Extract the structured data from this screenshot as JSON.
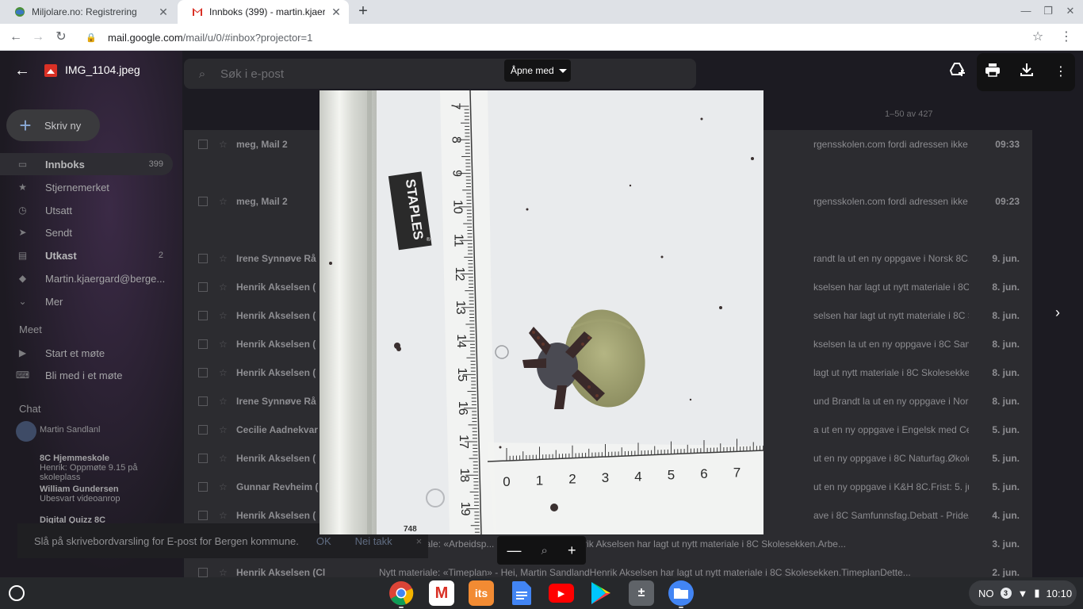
{
  "browser": {
    "tabs": [
      {
        "title": "Miljolare.no: Registrering",
        "active": false
      },
      {
        "title": "Innboks (399) - martin.kjaergard@",
        "active": true
      }
    ],
    "new_tab": "+",
    "url_host": "mail.google.com",
    "url_path": "/mail/u/0/#inbox?projector=1"
  },
  "gmail": {
    "search_placeholder": "Søk i e-post",
    "compose_label": "Skriv ny",
    "pagination": "1–50 av 427",
    "nav": [
      {
        "label": "Innboks",
        "count": "399",
        "icon": "inbox-icon"
      },
      {
        "label": "Stjernemerket",
        "count": "",
        "icon": "star-icon"
      },
      {
        "label": "Utsatt",
        "count": "",
        "icon": "clock-icon"
      },
      {
        "label": "Sendt",
        "count": "",
        "icon": "send-icon"
      },
      {
        "label": "Utkast",
        "count": "2",
        "icon": "draft-icon"
      },
      {
        "label": "Martin.kjaergard@berge...",
        "count": "",
        "icon": "label-icon"
      },
      {
        "label": "Mer",
        "count": "",
        "icon": "chevron-down-icon"
      }
    ],
    "meet_heading": "Meet",
    "meet": [
      {
        "label": "Start et møte",
        "icon": "video-icon"
      },
      {
        "label": "Bli med i et møte",
        "icon": "keyboard-icon"
      }
    ],
    "chat_heading": "Chat",
    "chat_user": "Martin Sandlanl",
    "chats": [
      {
        "name": "8C Hjemmeskole",
        "preview": "Henrik: Oppmøte 9.15 på skoleplass"
      },
      {
        "name": "William Gundersen",
        "preview": "Ubesvart videoanrop"
      },
      {
        "name": "Digital Quizz 8C",
        "preview": ""
      }
    ],
    "rows": [
      {
        "sender": "meg, Mail 2",
        "snippet": "rgensskolen.com fordi adressen ikke fin...",
        "date": "09:33"
      },
      {
        "sender": "meg, Mail 2",
        "snippet": "rgensskolen.com fordi adressen ikke fi...",
        "date": "09:23"
      },
      {
        "sender": "Irene Synnøve Rå",
        "snippet": "randt la ut en ny oppgave i Norsk 8C. Å ...",
        "date": "9. jun."
      },
      {
        "sender": "Henrik Akselsen (",
        "snippet": "kselsen har lagt ut nytt materiale i 8C ...",
        "date": "8. jun."
      },
      {
        "sender": "Henrik Akselsen (",
        "snippet": "selsen har lagt ut nytt materiale i 8C Sko...",
        "date": "8. jun."
      },
      {
        "sender": "Henrik Akselsen (",
        "snippet": "kselsen la ut en ny oppgave i 8C Samf...",
        "date": "8. jun."
      },
      {
        "sender": "Henrik Akselsen (",
        "snippet": "lagt ut nytt materiale i 8C Skolesekken.A...",
        "date": "8. jun."
      },
      {
        "sender": "Irene Synnøve Rå",
        "snippet": "und Brandt la ut en ny oppgave i Norsk ...",
        "date": "8. jun."
      },
      {
        "sender": "Cecilie Aadnekvar",
        "snippet": "a ut en ny oppgave i Engelsk med Cecil...",
        "date": "5. jun."
      },
      {
        "sender": "Henrik Akselsen (",
        "snippet": "ut en ny oppgave i 8C Naturfag.Økologi ...",
        "date": "5. jun."
      },
      {
        "sender": "Gunnar Revheim (",
        "snippet": "ut en ny oppgave i K&H 8C.Frist: 5. jun.D...",
        "date": "5. jun."
      },
      {
        "sender": "Henrik Akselsen (",
        "snippet": "ave i 8C Samfunnsfag.Debatt - PrideÅP...",
        "date": "4. jun."
      },
      {
        "sender": "",
        "snippet": "iale: «Arbeidsp... Martin SandlandHenrik Akselsen har lagt ut nytt materiale i 8C Skolesekken.Arbe...",
        "date": "3. jun."
      },
      {
        "sender": "Henrik Akselsen (Cl",
        "snippet": "Nytt materiale: «Timeplan» - Hei, Martin SandlandHenrik Akselsen har lagt ut nytt materiale i 8C Skolesekken.TimeplanDette...",
        "date": "2. jun."
      }
    ],
    "toast": {
      "text": "Slå på skrivebordvarsling for E-post for Bergen kommune.",
      "ok": "OK",
      "no": "Nei takk",
      "close": "×"
    }
  },
  "viewer": {
    "filename": "IMG_1104.jpeg",
    "open_with": "Åpne med",
    "ruler_labels_vertical": [
      "7",
      "8",
      "9",
      "10",
      "11",
      "12",
      "13",
      "14",
      "15",
      "16",
      "17",
      "18",
      "19"
    ],
    "ruler_labels_horizontal": [
      "0",
      "1",
      "2",
      "3",
      "4",
      "5",
      "6",
      "7"
    ],
    "brand_label": "STAPLES",
    "brand_mark": "®",
    "ruler_code": "748"
  },
  "shelf": {
    "apps": [
      {
        "name": "chrome-app-icon",
        "label": ""
      },
      {
        "name": "gmail-app-icon",
        "label": "M"
      },
      {
        "name": "its-app-icon",
        "label": "its"
      },
      {
        "name": "docs-app-icon",
        "label": ""
      },
      {
        "name": "youtube-app-icon",
        "label": "▶"
      },
      {
        "name": "play-store-app-icon",
        "label": "▶"
      },
      {
        "name": "calculator-app-icon",
        "label": "±"
      },
      {
        "name": "files-app-icon",
        "label": ""
      }
    ],
    "ime": "NO",
    "notif_count": "3",
    "time": "10:10"
  }
}
